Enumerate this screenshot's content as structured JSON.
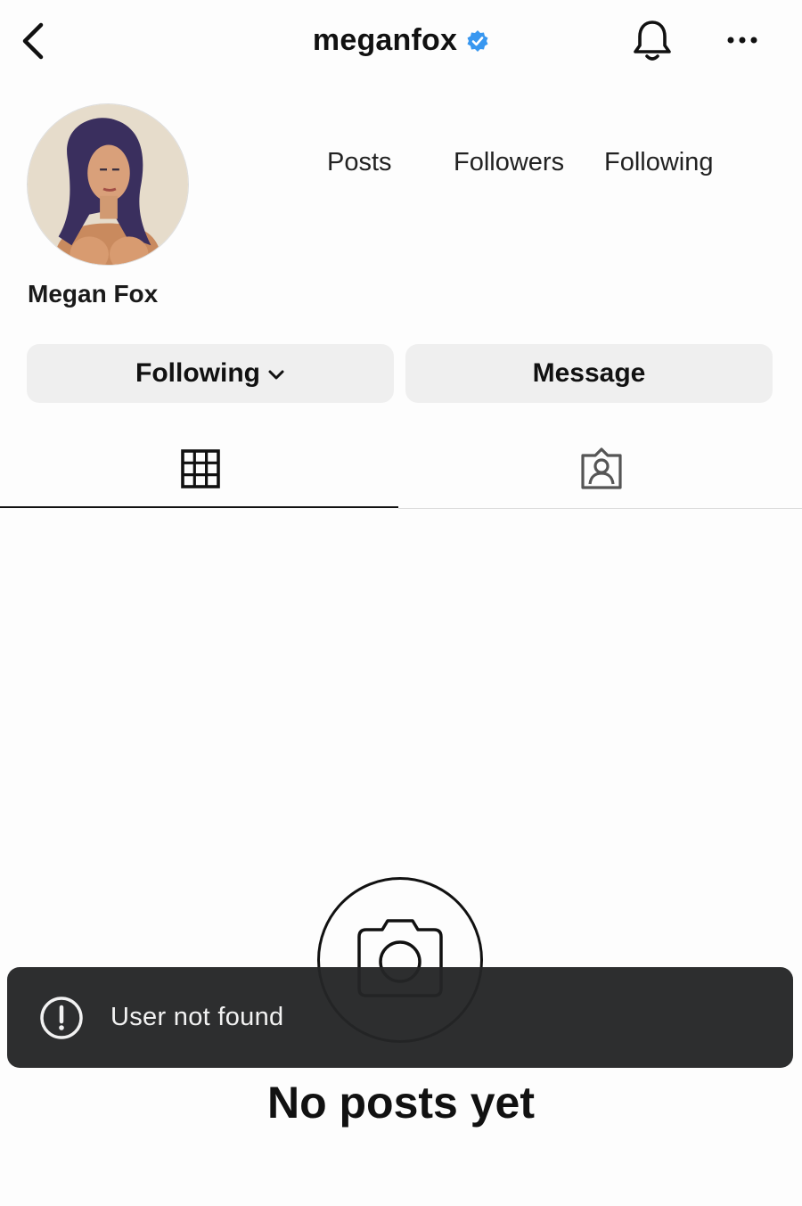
{
  "header": {
    "username": "meganfox",
    "verified": true,
    "icons": {
      "back": "chevron-left-icon",
      "verified": "verified-badge-icon",
      "notifications": "bell-icon",
      "more": "more-horizontal-icon"
    }
  },
  "profile": {
    "display_name": "Megan Fox",
    "stats": {
      "posts_label": "Posts",
      "followers_label": "Followers",
      "following_label": "Following"
    }
  },
  "actions": {
    "following_label": "Following",
    "message_label": "Message"
  },
  "tabs": [
    {
      "icon": "grid-icon",
      "selected": true
    },
    {
      "icon": "tagged-person-icon",
      "selected": false
    }
  ],
  "empty_state": {
    "icon": "camera-icon",
    "title": "No posts yet"
  },
  "toast": {
    "icon": "alert-circle-icon",
    "message": "User not found"
  },
  "colors": {
    "background": "#fdfdfd",
    "button_bg": "#efefef",
    "verified_blue": "#3897f0",
    "toast_bg": "#242526"
  }
}
